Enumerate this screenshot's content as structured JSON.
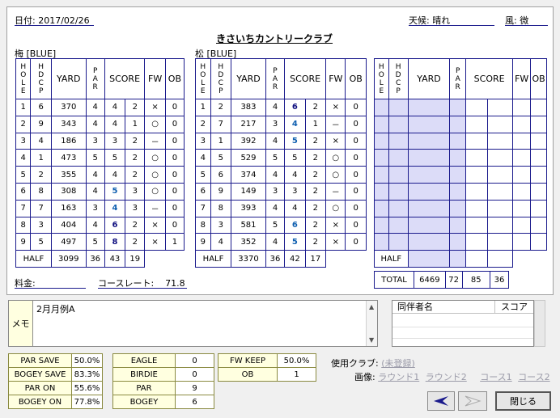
{
  "header": {
    "date_label": "日付",
    "date": "2017/02/26",
    "weather_label": "天候",
    "weather": "晴れ",
    "wind_label": "風",
    "wind": "微",
    "course_name": "きさいちカントリークラブ"
  },
  "columns": {
    "hole": "HOLE",
    "hdcp": "HDCP",
    "yard": "YARD",
    "par": "PAR",
    "score": "SCORE",
    "fw": "FW",
    "ob": "OB",
    "half": "HALF",
    "total": "TOTAL"
  },
  "rounds": [
    {
      "name": "梅 [BLUE]",
      "holes": [
        {
          "hole": "1",
          "hdcp": "6",
          "yard": "370",
          "par": "4",
          "score": "4",
          "putts": "2",
          "fw": "×",
          "ob": "0"
        },
        {
          "hole": "2",
          "hdcp": "9",
          "yard": "343",
          "par": "4",
          "score": "4",
          "putts": "1",
          "fw": "○",
          "ob": "0"
        },
        {
          "hole": "3",
          "hdcp": "4",
          "yard": "186",
          "par": "3",
          "score": "3",
          "putts": "2",
          "fw": "－",
          "ob": "0"
        },
        {
          "hole": "4",
          "hdcp": "1",
          "yard": "473",
          "par": "5",
          "score": "5",
          "putts": "2",
          "fw": "○",
          "ob": "0"
        },
        {
          "hole": "5",
          "hdcp": "2",
          "yard": "355",
          "par": "4",
          "score": "4",
          "putts": "2",
          "fw": "○",
          "ob": "0"
        },
        {
          "hole": "6",
          "hdcp": "8",
          "yard": "308",
          "par": "4",
          "score": "5",
          "putts": "3",
          "fw": "○",
          "ob": "0"
        },
        {
          "hole": "7",
          "hdcp": "7",
          "yard": "163",
          "par": "3",
          "score": "4",
          "putts": "3",
          "fw": "－",
          "ob": "0"
        },
        {
          "hole": "8",
          "hdcp": "3",
          "yard": "404",
          "par": "4",
          "score": "6",
          "putts": "2",
          "fw": "×",
          "ob": "0"
        },
        {
          "hole": "9",
          "hdcp": "5",
          "yard": "497",
          "par": "5",
          "score": "8",
          "putts": "2",
          "fw": "×",
          "ob": "1"
        }
      ],
      "half": {
        "yard": "3099",
        "par": "36",
        "score": "43",
        "putts": "19"
      }
    },
    {
      "name": "松 [BLUE]",
      "holes": [
        {
          "hole": "1",
          "hdcp": "2",
          "yard": "383",
          "par": "4",
          "score": "6",
          "putts": "2",
          "fw": "×",
          "ob": "0"
        },
        {
          "hole": "2",
          "hdcp": "7",
          "yard": "217",
          "par": "3",
          "score": "4",
          "putts": "1",
          "fw": "－",
          "ob": "0"
        },
        {
          "hole": "3",
          "hdcp": "1",
          "yard": "392",
          "par": "4",
          "score": "5",
          "putts": "2",
          "fw": "×",
          "ob": "0"
        },
        {
          "hole": "4",
          "hdcp": "5",
          "yard": "529",
          "par": "5",
          "score": "5",
          "putts": "2",
          "fw": "○",
          "ob": "0"
        },
        {
          "hole": "5",
          "hdcp": "6",
          "yard": "374",
          "par": "4",
          "score": "4",
          "putts": "2",
          "fw": "○",
          "ob": "0"
        },
        {
          "hole": "6",
          "hdcp": "9",
          "yard": "149",
          "par": "3",
          "score": "3",
          "putts": "2",
          "fw": "－",
          "ob": "0"
        },
        {
          "hole": "7",
          "hdcp": "8",
          "yard": "393",
          "par": "4",
          "score": "4",
          "putts": "2",
          "fw": "○",
          "ob": "0"
        },
        {
          "hole": "8",
          "hdcp": "3",
          "yard": "581",
          "par": "5",
          "score": "6",
          "putts": "2",
          "fw": "×",
          "ob": "0"
        },
        {
          "hole": "9",
          "hdcp": "4",
          "yard": "352",
          "par": "4",
          "score": "5",
          "putts": "2",
          "fw": "×",
          "ob": "0"
        }
      ],
      "half": {
        "yard": "3370",
        "par": "36",
        "score": "42",
        "putts": "17"
      }
    }
  ],
  "total": {
    "yard": "6469",
    "par": "72",
    "score": "85",
    "putts": "36"
  },
  "fee_label": "料金",
  "course_rate_label": "コースレート",
  "course_rate": "71.8",
  "memo": {
    "label": "メモ",
    "text": "2月月例A"
  },
  "companions": {
    "name_header": "同伴者名",
    "score_header": "スコア"
  },
  "stats": {
    "col1": [
      {
        "label": "PAR SAVE",
        "value": "50.0%"
      },
      {
        "label": "BOGEY SAVE",
        "value": "83.3%"
      },
      {
        "label": "PAR ON",
        "value": "55.6%"
      },
      {
        "label": "BOGEY ON",
        "value": "77.8%"
      }
    ],
    "col2": [
      {
        "label": "EAGLE",
        "value": "0"
      },
      {
        "label": "BIRDIE",
        "value": "0"
      },
      {
        "label": "PAR",
        "value": "9"
      },
      {
        "label": "BOGEY",
        "value": "6"
      }
    ],
    "col3": [
      {
        "label": "FW KEEP",
        "value": "50.0%"
      },
      {
        "label": "OB",
        "value": "1"
      }
    ]
  },
  "clubs_label": "使用クラブ:",
  "clubs_value": "(未登録)",
  "images_label": "画像:",
  "image_links": [
    "ラウンド1",
    "ラウンド2",
    "コース1",
    "コース2"
  ],
  "buttons": {
    "close": "閉じる"
  },
  "colors": {
    "grid": "#1a1a8c",
    "empty_cell": "#dcdcf8",
    "stat_key": "#ffffe0",
    "score_blue": "#1060b0",
    "score_navy": "#101080"
  }
}
